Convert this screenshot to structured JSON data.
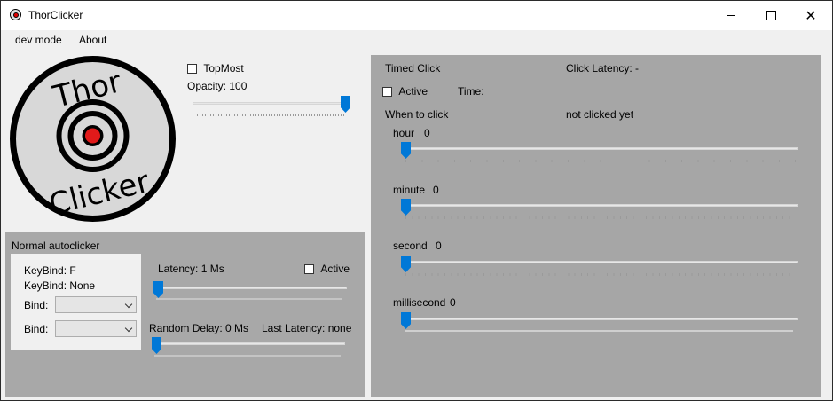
{
  "window": {
    "title": "ThorClicker",
    "minimize": "minimize",
    "maximize": "maximize",
    "close": "close"
  },
  "menu": {
    "items": [
      "dev mode",
      "About"
    ]
  },
  "logo": {
    "line1": "Thor",
    "line2": "Clicker"
  },
  "top_controls": {
    "topmost_label": "TopMost",
    "topmost_checked": false,
    "opacity_label": "Opacity: 100",
    "opacity_value": 100
  },
  "normal": {
    "title": "Normal autoclicker",
    "keybind1": "KeyBind: F",
    "keybind2": "KeyBind: None",
    "bind_label1": "Bind:",
    "bind_label2": "Bind:",
    "bind_value1": "",
    "bind_value2": "",
    "latency_label": "Latency: 1 Ms",
    "active_label": "Active",
    "active_checked": false,
    "latency_value": 1,
    "random_delay_label": "Random Delay: 0 Ms",
    "random_delay_value": 0,
    "last_latency_label": "Last Latency: none"
  },
  "timed": {
    "title": "Timed Click",
    "click_latency_label": "Click Latency: -",
    "active_label": "Active",
    "active_checked": false,
    "time_label": "Time:",
    "when_label": "When to click",
    "status": "not clicked yet",
    "sliders": [
      {
        "name": "hour",
        "value": "0"
      },
      {
        "name": "minute",
        "value": "0"
      },
      {
        "name": "second",
        "value": "0"
      },
      {
        "name": "millisecond",
        "value": "0"
      }
    ]
  },
  "colors": {
    "accent": "#0078d7",
    "panel": "#a8a8a8",
    "window": "#f0f0f0",
    "logo_red": "#e11a1a"
  }
}
